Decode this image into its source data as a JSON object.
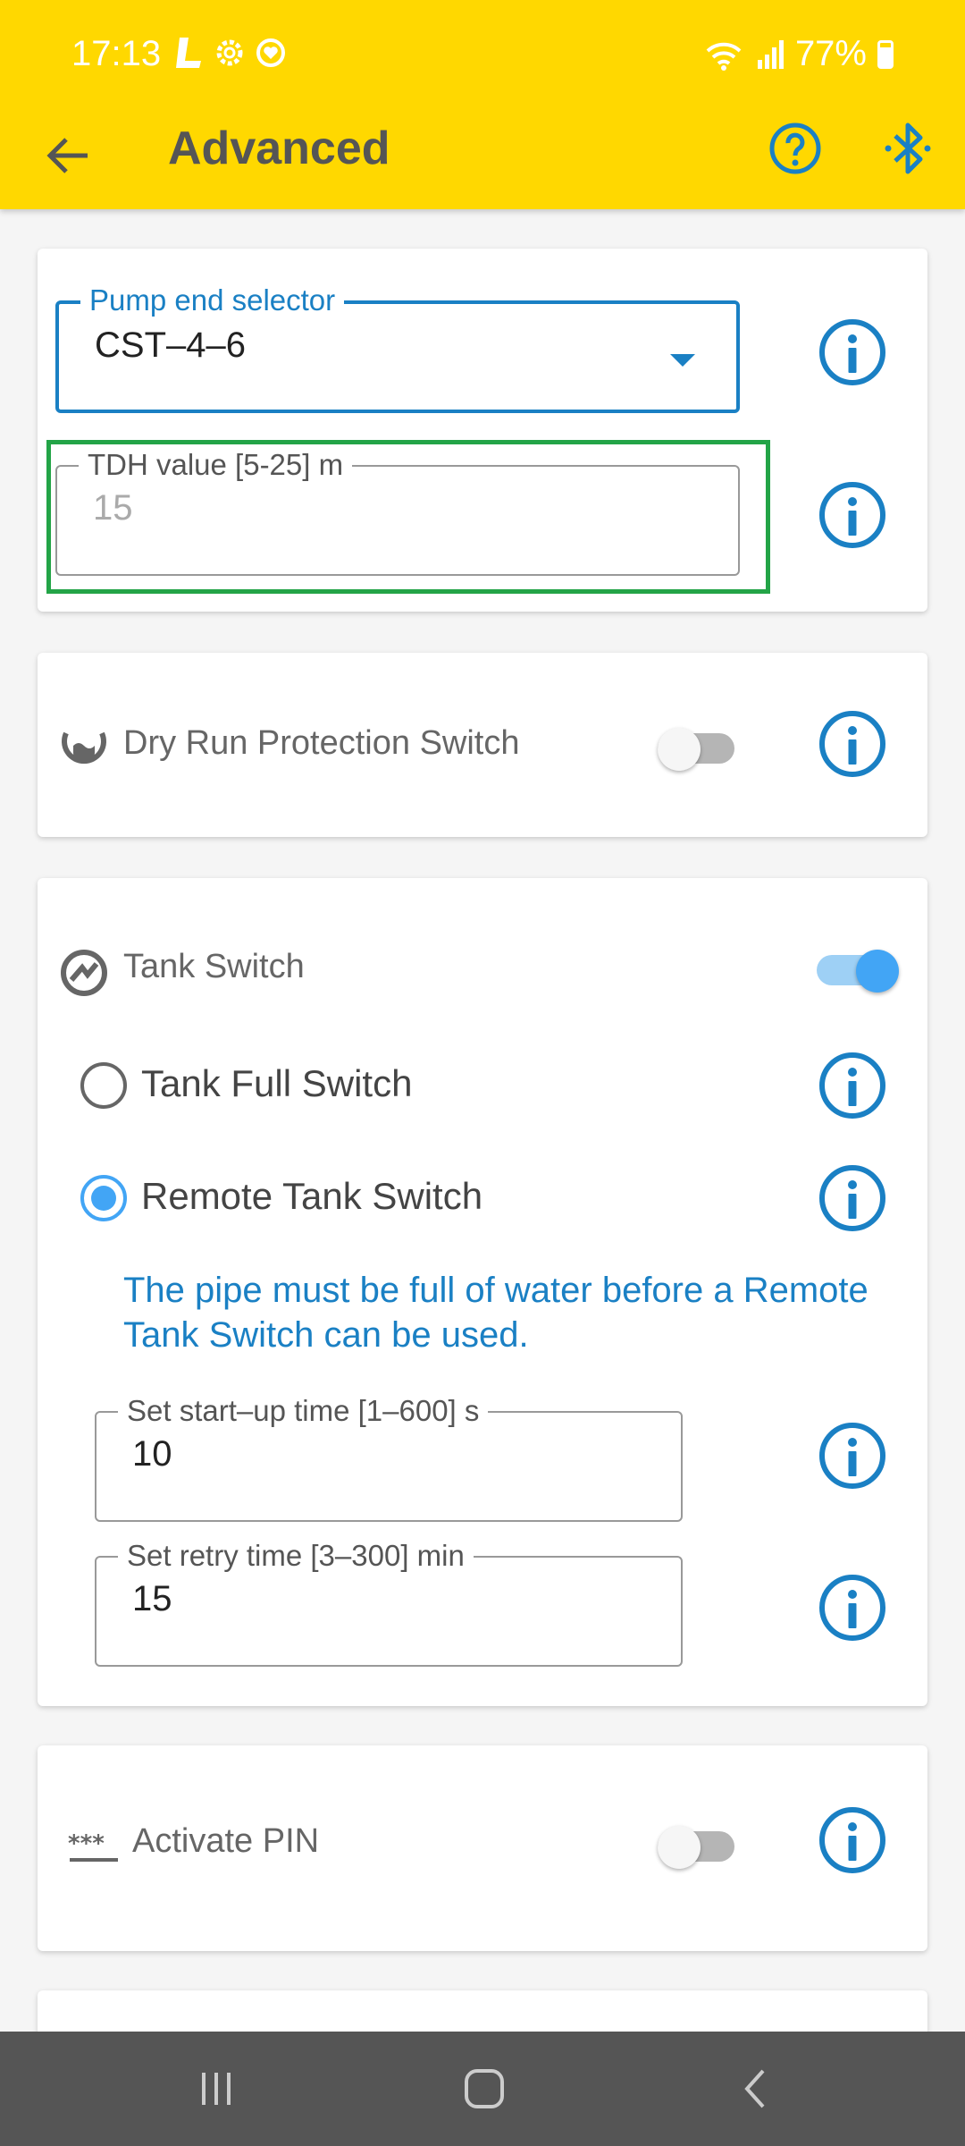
{
  "status_bar": {
    "time": "17:13",
    "battery": "77%"
  },
  "toolbar": {
    "title": "Advanced"
  },
  "pump_card": {
    "pump_end_selector": {
      "label": "Pump end selector",
      "value": "CST–4–6"
    },
    "tdh": {
      "label": "TDH value [5-25] m",
      "value": "15"
    }
  },
  "dry_run": {
    "label": "Dry Run Protection Switch",
    "enabled": false
  },
  "tank": {
    "label": "Tank Switch",
    "enabled": true,
    "options": [
      {
        "label": "Tank Full Switch",
        "selected": false
      },
      {
        "label": "Remote Tank Switch",
        "selected": true
      }
    ],
    "note": "The pipe must be full of water before a Remote Tank Switch can be used.",
    "startup": {
      "label": "Set start–up time [1–600] s",
      "value": "10"
    },
    "retry": {
      "label": "Set retry time [3–300] min",
      "value": "15"
    }
  },
  "pin": {
    "label": "Activate PIN",
    "enabled": false
  },
  "colors": {
    "appbar": "#ffd800",
    "accent": "#1a80c4",
    "toggle_on": "#42a5f5",
    "highlight": "#23a447"
  }
}
